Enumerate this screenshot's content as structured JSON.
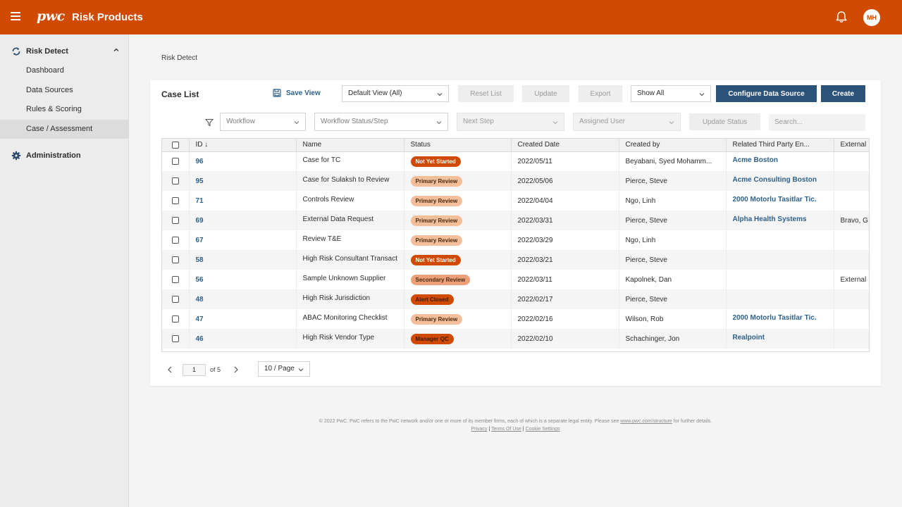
{
  "header": {
    "logo_text": "pwc",
    "app_title": "Risk Products",
    "avatar_initials": "MH"
  },
  "sidebar": {
    "section_risk": "Risk Detect",
    "items": [
      {
        "label": "Dashboard"
      },
      {
        "label": "Data Sources"
      },
      {
        "label": "Rules & Scoring"
      },
      {
        "label": "Case / Assessment"
      }
    ],
    "section_admin": "Administration"
  },
  "breadcrumb": "Risk Detect",
  "case_list": {
    "title": "Case List",
    "save_view": "Save View",
    "view_select": "Default View (All)",
    "reset_list": "Reset List",
    "update": "Update",
    "export": "Export",
    "show_select": "Show All",
    "configure": "Configure Data Source",
    "create": "Create"
  },
  "filters": {
    "workflow": "Workflow",
    "workflow_status": "Workflow Status/Step",
    "next_step": "Next Step",
    "assigned_user": "Assigned User",
    "update_status": "Update Status",
    "search_placeholder": "Search..."
  },
  "table": {
    "columns": [
      "ID ↓",
      "Name",
      "Status",
      "Created Date",
      "Created by",
      "Related Third Party En...",
      "External"
    ],
    "rows": [
      {
        "id": "96",
        "name": "Case for TC",
        "status": "Not Yet Started",
        "date": "2022/05/11",
        "by": "Beyabani, Syed Mohamm...",
        "third": "Acme Boston",
        "ext": ""
      },
      {
        "id": "95",
        "name": "Case for Sulaksh to Review",
        "status": "Primary Review",
        "date": "2022/05/06",
        "by": "Pierce, Steve",
        "third": "Acme Consulting Boston",
        "ext": ""
      },
      {
        "id": "71",
        "name": "Controls Review",
        "status": "Primary Review",
        "date": "2022/04/04",
        "by": "Ngo, Linh",
        "third": "2000 Motorlu Tasitlar Tic.",
        "ext": ""
      },
      {
        "id": "69",
        "name": "External Data Request",
        "status": "Primary Review",
        "date": "2022/03/31",
        "by": "Pierce, Steve",
        "third": "Alpha Health Systems",
        "ext": "Bravo, G"
      },
      {
        "id": "67",
        "name": "Review T&E",
        "status": "Primary Review",
        "date": "2022/03/29",
        "by": "Ngo, Linh",
        "third": "",
        "ext": ""
      },
      {
        "id": "58",
        "name": "High Risk Consultant Transact",
        "status": "Not Yet Started",
        "date": "2022/03/21",
        "by": "Pierce, Steve",
        "third": "",
        "ext": ""
      },
      {
        "id": "56",
        "name": "Sample Unknown Supplier",
        "status": "Secondary Review",
        "date": "2022/03/11",
        "by": "Kapolnek, Dan",
        "third": "",
        "ext": "External"
      },
      {
        "id": "48",
        "name": "High Risk Jurisdiction",
        "status": "Alert Closed",
        "date": "2022/02/17",
        "by": "Pierce, Steve",
        "third": "",
        "ext": ""
      },
      {
        "id": "47",
        "name": "ABAC Monitoring Checklist",
        "status": "Primary Review",
        "date": "2022/02/16",
        "by": "Wilson, Rob",
        "third": "2000 Motorlu Tasitlar Tic.",
        "ext": ""
      },
      {
        "id": "46",
        "name": "High Risk Vendor Type",
        "status": "Manager QC",
        "date": "2022/02/10",
        "by": "Schachinger, Jon",
        "third": "Realpoint",
        "ext": ""
      }
    ]
  },
  "pagination": {
    "current_page": "1",
    "of_text": "of 5",
    "per_page": "10 / Page"
  },
  "footer": {
    "text": "© 2022 PwC. PwC refers to the PwC network and/or one or more of its member firms, each of which is a separate legal entity. Please see",
    "link": "www.pwc.com/structure",
    "text_end": "for further details.",
    "privacy": "Privacy",
    "terms": "Terms Of Use",
    "cookies": "Cookie Settings",
    "sep": "|"
  },
  "colors": {
    "brand": "#d04a02",
    "primary_button": "#2b5278",
    "link": "#2c5f8a"
  }
}
